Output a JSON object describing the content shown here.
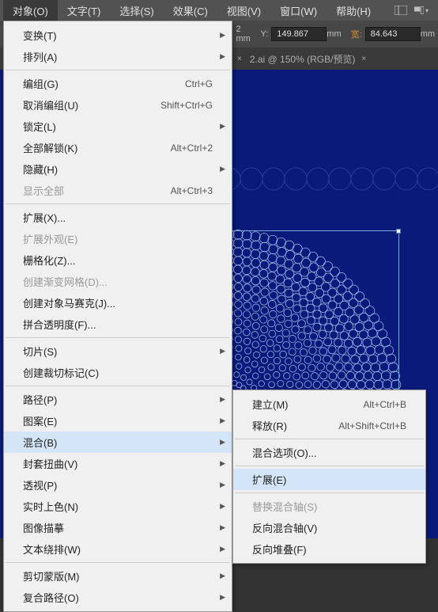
{
  "menubar": {
    "items": [
      "对象(O)",
      "文字(T)",
      "选择(S)",
      "效果(C)",
      "视图(V)",
      "窗口(W)",
      "帮助(H)"
    ]
  },
  "optionbar": {
    "y_label": "Y:",
    "y_value": "149.867",
    "y_unit": "mm",
    "w_label": "宽:",
    "w_value": "84.643",
    "w_unit": "mm",
    "x_unit": "2 mm"
  },
  "doctab": {
    "label": "2.ai @ 150% (RGB/预览)"
  },
  "menu": {
    "items": [
      {
        "label": "变换(T)",
        "sub": true
      },
      {
        "label": "排列(A)",
        "sub": true
      },
      {
        "sep": true
      },
      {
        "label": "编组(G)",
        "shortcut": "Ctrl+G"
      },
      {
        "label": "取消编组(U)",
        "shortcut": "Shift+Ctrl+G"
      },
      {
        "label": "锁定(L)",
        "sub": true
      },
      {
        "label": "全部解锁(K)",
        "shortcut": "Alt+Ctrl+2"
      },
      {
        "label": "隐藏(H)",
        "sub": true
      },
      {
        "label": "显示全部",
        "shortcut": "Alt+Ctrl+3",
        "disabled": true
      },
      {
        "sep": true
      },
      {
        "label": "扩展(X)..."
      },
      {
        "label": "扩展外观(E)",
        "disabled": true
      },
      {
        "label": "栅格化(Z)..."
      },
      {
        "label": "创建渐变网格(D)...",
        "disabled": true
      },
      {
        "label": "创建对象马赛克(J)..."
      },
      {
        "label": "拼合透明度(F)..."
      },
      {
        "sep": true
      },
      {
        "label": "切片(S)",
        "sub": true
      },
      {
        "label": "创建裁切标记(C)"
      },
      {
        "sep": true
      },
      {
        "label": "路径(P)",
        "sub": true
      },
      {
        "label": "图案(E)",
        "sub": true
      },
      {
        "label": "混合(B)",
        "sub": true,
        "highlight": true
      },
      {
        "label": "封套扭曲(V)",
        "sub": true
      },
      {
        "label": "透视(P)",
        "sub": true
      },
      {
        "label": "实时上色(N)",
        "sub": true
      },
      {
        "label": "图像描摹",
        "sub": true
      },
      {
        "label": "文本绕排(W)",
        "sub": true
      },
      {
        "sep": true
      },
      {
        "label": "剪切蒙版(M)",
        "sub": true
      },
      {
        "label": "复合路径(O)",
        "sub": true
      }
    ]
  },
  "submenu": {
    "items": [
      {
        "label": "建立(M)",
        "shortcut": "Alt+Ctrl+B"
      },
      {
        "label": "释放(R)",
        "shortcut": "Alt+Shift+Ctrl+B"
      },
      {
        "sep": true
      },
      {
        "label": "混合选项(O)..."
      },
      {
        "sep": true
      },
      {
        "label": "扩展(E)",
        "highlight": true
      },
      {
        "sep": true
      },
      {
        "label": "替换混合轴(S)",
        "disabled": true
      },
      {
        "label": "反向混合轴(V)"
      },
      {
        "label": "反向堆叠(F)"
      }
    ]
  }
}
